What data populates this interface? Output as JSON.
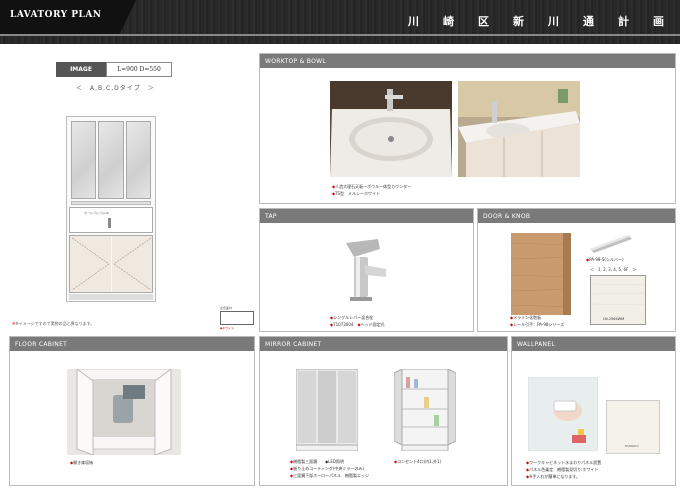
{
  "header": {
    "plan_title": "LAVATORY PLAN",
    "project_chars": [
      "川",
      "崎",
      "区",
      "新",
      "川",
      "通",
      "計",
      "画"
    ]
  },
  "plan": {
    "image_label": "IMAGE",
    "size_text": "L=900 D=550",
    "type_nav": "＜　A,B,C,Dタイプ　＞",
    "bowl_label": "ボールバルブ(A,B)",
    "note": "※イメージですので実物の品と異なります。",
    "swatch_label": "扉色面材",
    "swatch_caption": "◆ホワイト"
  },
  "worktop": {
    "title": "WORKTOP & BOWL",
    "bullets": [
      "人造大理石天板一ボウル一体型カウンター",
      "TS型　メルレーホワイト"
    ]
  },
  "tap": {
    "title": "TAP",
    "bullets": [
      "シングルレバー混合栓",
      "71073004",
      "ヘッド固定式"
    ]
  },
  "door": {
    "title": "DOOR & KNOB",
    "bullets": [
      "メラミン化粧板",
      "レール引手：PA-98シリーズ"
    ],
    "knob_label": "PA-98-S(シルバー)",
    "knob_types": "＜　1, 2, 3, 4, 5, 6F　＞",
    "door_code": "LN-2564WM"
  },
  "floor": {
    "title": "FLOOR CABINET",
    "bullets": [
      "開き扉収納"
    ]
  },
  "mirror": {
    "title": "MIRROR CABINET",
    "bullets_left": [
      "樹脂製三面鏡　　◆LED照明",
      "曇り止めコーティング(中央ミラーのみ)",
      "三面鏡下部ホーローパネル　樹脂製エッジ"
    ],
    "bullets_right": [
      "コンセント4口(内1,外1)"
    ]
  },
  "wall": {
    "title": "WALLPANEL",
    "bullets": [
      "ワークキャビネット水まわりパネル設置",
      "パネル色乗定　樹脂製見切り:ホワイト",
      "※手入れが簡単になります。"
    ],
    "panel_brand": "PANNIDO"
  },
  "colors": {
    "header_bg": "#2b2b2b",
    "panel_head": "#7a7a7a",
    "bullet_mark": "#dd0000"
  }
}
